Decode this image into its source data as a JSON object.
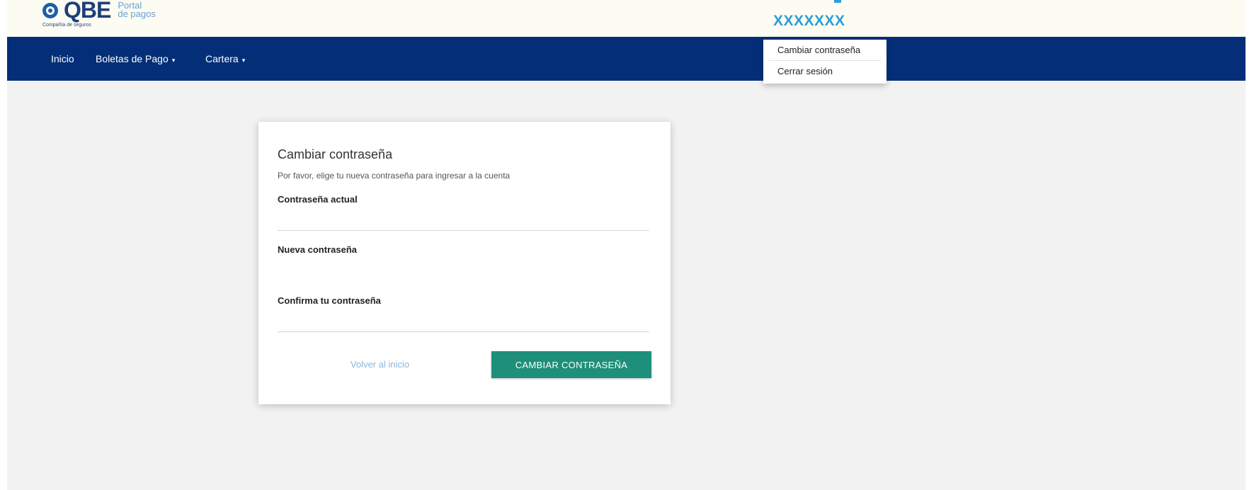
{
  "header": {
    "logo_text": "QBE",
    "logo_tagline": "Compañía de seguros",
    "portal_line1": "Portal",
    "portal_line2": "de pagos",
    "user_name": "XXXXXXX"
  },
  "nav": {
    "items": [
      {
        "label": "Inicio",
        "has_caret": false
      },
      {
        "label": "Boletas de Pago",
        "has_caret": true
      },
      {
        "label": "Cartera",
        "has_caret": true
      }
    ],
    "caret": "▾"
  },
  "user_menu": {
    "items": [
      "Cambiar contraseña",
      "Cerrar sesión"
    ]
  },
  "form": {
    "title": "Cambiar contraseña",
    "description": "Por favor, elige tu nueva contraseña para ingresar a la cuenta",
    "fields": [
      {
        "label": "Contraseña actual",
        "value": ""
      },
      {
        "label": "Nueva contraseña",
        "value": ""
      },
      {
        "label": "Confirma tu contraseña",
        "value": ""
      }
    ],
    "back_link": "Volver al inicio",
    "submit_label": "CAMBIAR CONTRASEÑA"
  },
  "colors": {
    "navbar": "#042f78",
    "accent_button": "#1d8f7a",
    "user_name": "#2b9fd8",
    "page_bg": "#f2f2f2"
  }
}
